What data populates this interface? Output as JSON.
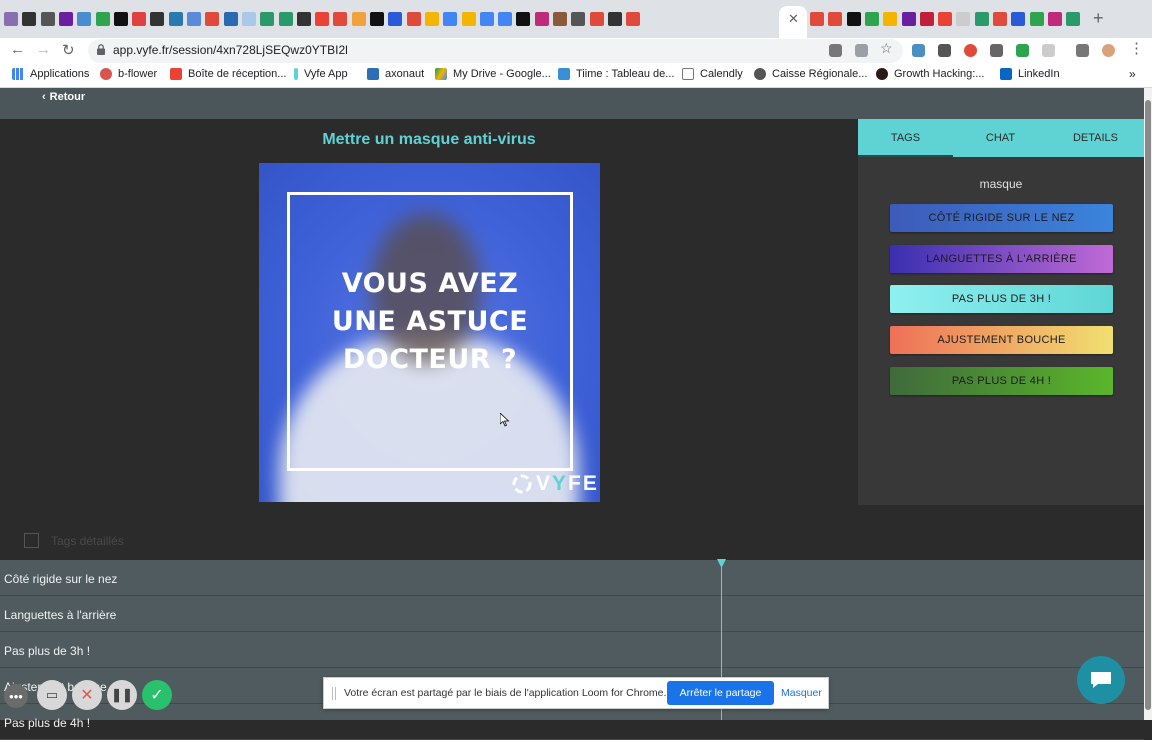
{
  "browser": {
    "url": "app.vyfe.fr/session/4xn728LjSEQwz0YTBI2l",
    "bookmarks": [
      {
        "label": "Applications",
        "icon": "apps-grid-icon"
      },
      {
        "label": "b-flower",
        "icon": "flower-icon"
      },
      {
        "label": "Boîte de réception...",
        "icon": "gmail-icon"
      },
      {
        "label": "Vyfe App",
        "icon": "vyfe-icon"
      },
      {
        "label": "axonaut",
        "icon": "axonaut-icon"
      },
      {
        "label": "My Drive - Google...",
        "icon": "drive-icon"
      },
      {
        "label": "Tiime : Tableau de...",
        "icon": "tiime-icon"
      },
      {
        "label": "Calendly",
        "icon": "calendly-icon"
      },
      {
        "label": "Caisse Régionale...",
        "icon": "globe-icon"
      },
      {
        "label": "Growth Hacking:...",
        "icon": "growth-icon"
      },
      {
        "label": "LinkedIn",
        "icon": "linkedin-icon"
      }
    ]
  },
  "app": {
    "back_label": "Retour",
    "video_title": "Mettre un masque anti-virus",
    "video_overlay": [
      "VOUS AVEZ",
      "UNE ASTUCE",
      "DOCTEUR ?"
    ],
    "video_brand": {
      "prefix": "V",
      "accent": "Y",
      "suffix": "FE"
    },
    "tabs": {
      "tags": "TAGS",
      "chat": "CHAT",
      "details": "DETAILS"
    },
    "tags_heading": "masque",
    "tag_buttons": [
      {
        "label": "CÔTÉ RIGIDE SUR LE NEZ",
        "colors": [
          "#3d5bb8",
          "#3b84dc"
        ]
      },
      {
        "label": "LANGUETTES À L'ARRIÈRE",
        "colors": [
          "#3a2fb0",
          "#c06ad6"
        ]
      },
      {
        "label": "PAS PLUS DE 3H !",
        "colors": [
          "#8ff0ef",
          "#5fd6d6"
        ]
      },
      {
        "label": "AJUSTEMENT BOUCHE",
        "colors": [
          "#ee7058",
          "#f1e070"
        ]
      },
      {
        "label": "PAS PLUS DE 4H !",
        "colors": [
          "#3f6a3c",
          "#5ab62a"
        ]
      }
    ],
    "details_toggle_label": "Tags détaillés",
    "timeline_rows": [
      "Côté rigide sur le nez",
      "Languettes à l'arrière",
      "Pas plus de 3h !",
      "Ajustement bouche",
      "Pas plus de 4h !"
    ]
  },
  "share_bar": {
    "message": "Votre écran est partagé par le biais de l'application Loom for Chrome.",
    "stop_label": "Arrêter le partage",
    "hide_label": "Masquer"
  },
  "colors": {
    "accent": "#5fd3d3",
    "header": "#4a565a",
    "timeline": "#4f5b5e",
    "background": "#2b2b2b"
  }
}
